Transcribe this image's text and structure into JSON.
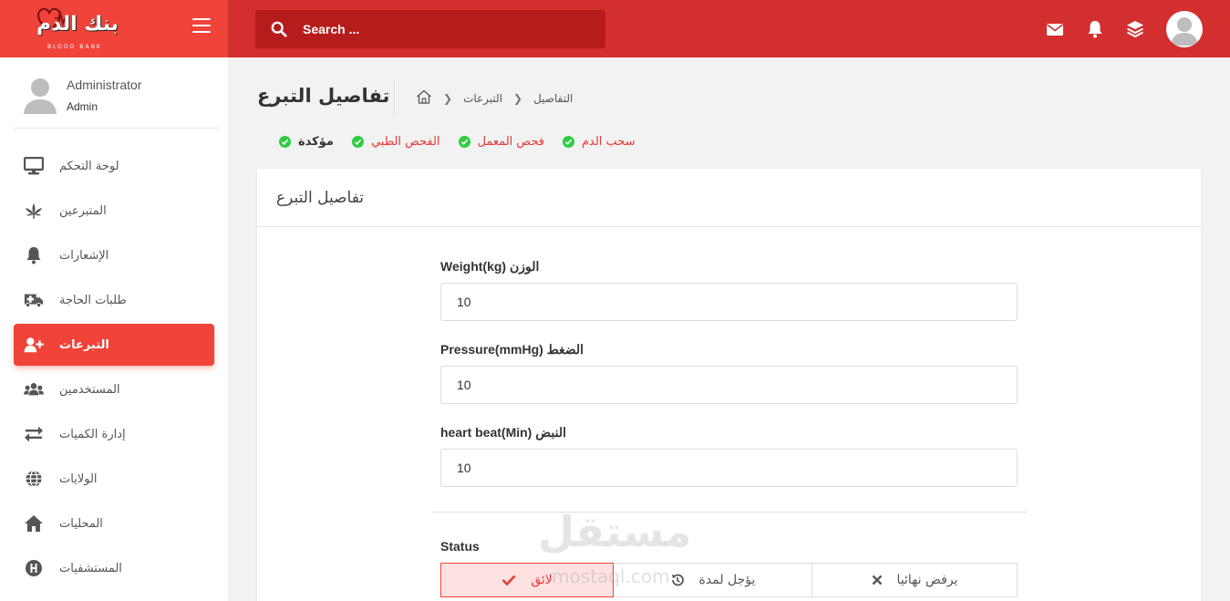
{
  "brand": {
    "logo_text": "بنك الدم",
    "logo_sub": "BLOOD BANK",
    "color": "#f0433a"
  },
  "header": {
    "search_placeholder": "Search ...",
    "icons": [
      "envelope-icon",
      "bell-icon",
      "layers-icon",
      "user-avatar"
    ],
    "color": "#d32f2f"
  },
  "sidebar": {
    "user": {
      "name": "Administrator",
      "role": "Admin"
    },
    "items": [
      {
        "label": "لوحة التحكم",
        "icon": "monitor-icon",
        "active": false
      },
      {
        "label": "المتبرعين",
        "icon": "leaf-icon",
        "active": false
      },
      {
        "label": "الإشعارات",
        "icon": "bell-icon",
        "active": false
      },
      {
        "label": "طلبات الحاجة",
        "icon": "ambulance-icon",
        "active": false
      },
      {
        "label": "التبرعات",
        "icon": "user-plus-icon",
        "active": true
      },
      {
        "label": "المستخدمين",
        "icon": "users-icon",
        "active": false
      },
      {
        "label": "إدارة الكميات",
        "icon": "exchange-icon",
        "active": false
      },
      {
        "label": "الولايات",
        "icon": "globe-icon",
        "active": false
      },
      {
        "label": "المحليات",
        "icon": "home-icon",
        "active": false
      },
      {
        "label": "المستشفيات",
        "icon": "hospital-icon",
        "active": false
      }
    ]
  },
  "page": {
    "title": "تفاصيل التبرع",
    "breadcrumb": [
      "التبرعات",
      "التفاصيل"
    ]
  },
  "steps": [
    {
      "label": "سحب الدم"
    },
    {
      "label": "فحص المعمل"
    },
    {
      "label": "الفحص الطبي"
    },
    {
      "label": "مؤكدة"
    }
  ],
  "card": {
    "title": "تفاصيل التبرع",
    "fields": [
      {
        "label": "Weight(kg) الوزن",
        "value": "10"
      },
      {
        "label": "Pressure(mmHg) الضغط",
        "value": "10"
      },
      {
        "label": "heart beat(Min) النبض",
        "value": "10"
      }
    ],
    "status_label": "Status",
    "status_buttons": {
      "accept": "لائق",
      "postpone": "يؤجل لمدة",
      "reject": "يرفض نهائيا"
    }
  },
  "watermark": {
    "main": "مستقل",
    "sub": "mostaql.com"
  }
}
